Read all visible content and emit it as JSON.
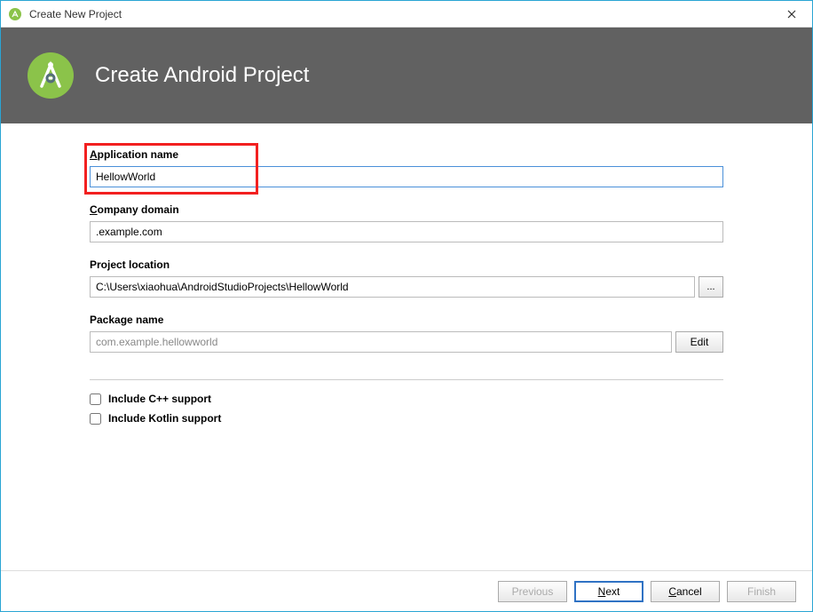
{
  "window": {
    "title": "Create New Project"
  },
  "banner": {
    "title": "Create Android Project"
  },
  "fields": {
    "app_name": {
      "label_pre": "A",
      "label_rest": "pplication name",
      "value": "HellowWorld"
    },
    "company_domain": {
      "label_pre": "C",
      "label_rest": "ompany domain",
      "value": ".example.com"
    },
    "project_location": {
      "label": "Project location",
      "value": "C:\\Users\\xiaohua\\AndroidStudioProjects\\HellowWorld",
      "browse": "..."
    },
    "package_name": {
      "label": "Package name",
      "value": "com.example.hellowworld",
      "edit": "Edit"
    }
  },
  "checkboxes": {
    "cpp": "Include C++ support",
    "kotlin": "Include Kotlin support"
  },
  "footer": {
    "previous": "Previous",
    "next_pre": "N",
    "next_rest": "ext",
    "cancel_pre": "C",
    "cancel_rest": "ancel",
    "finish": "Finish"
  }
}
